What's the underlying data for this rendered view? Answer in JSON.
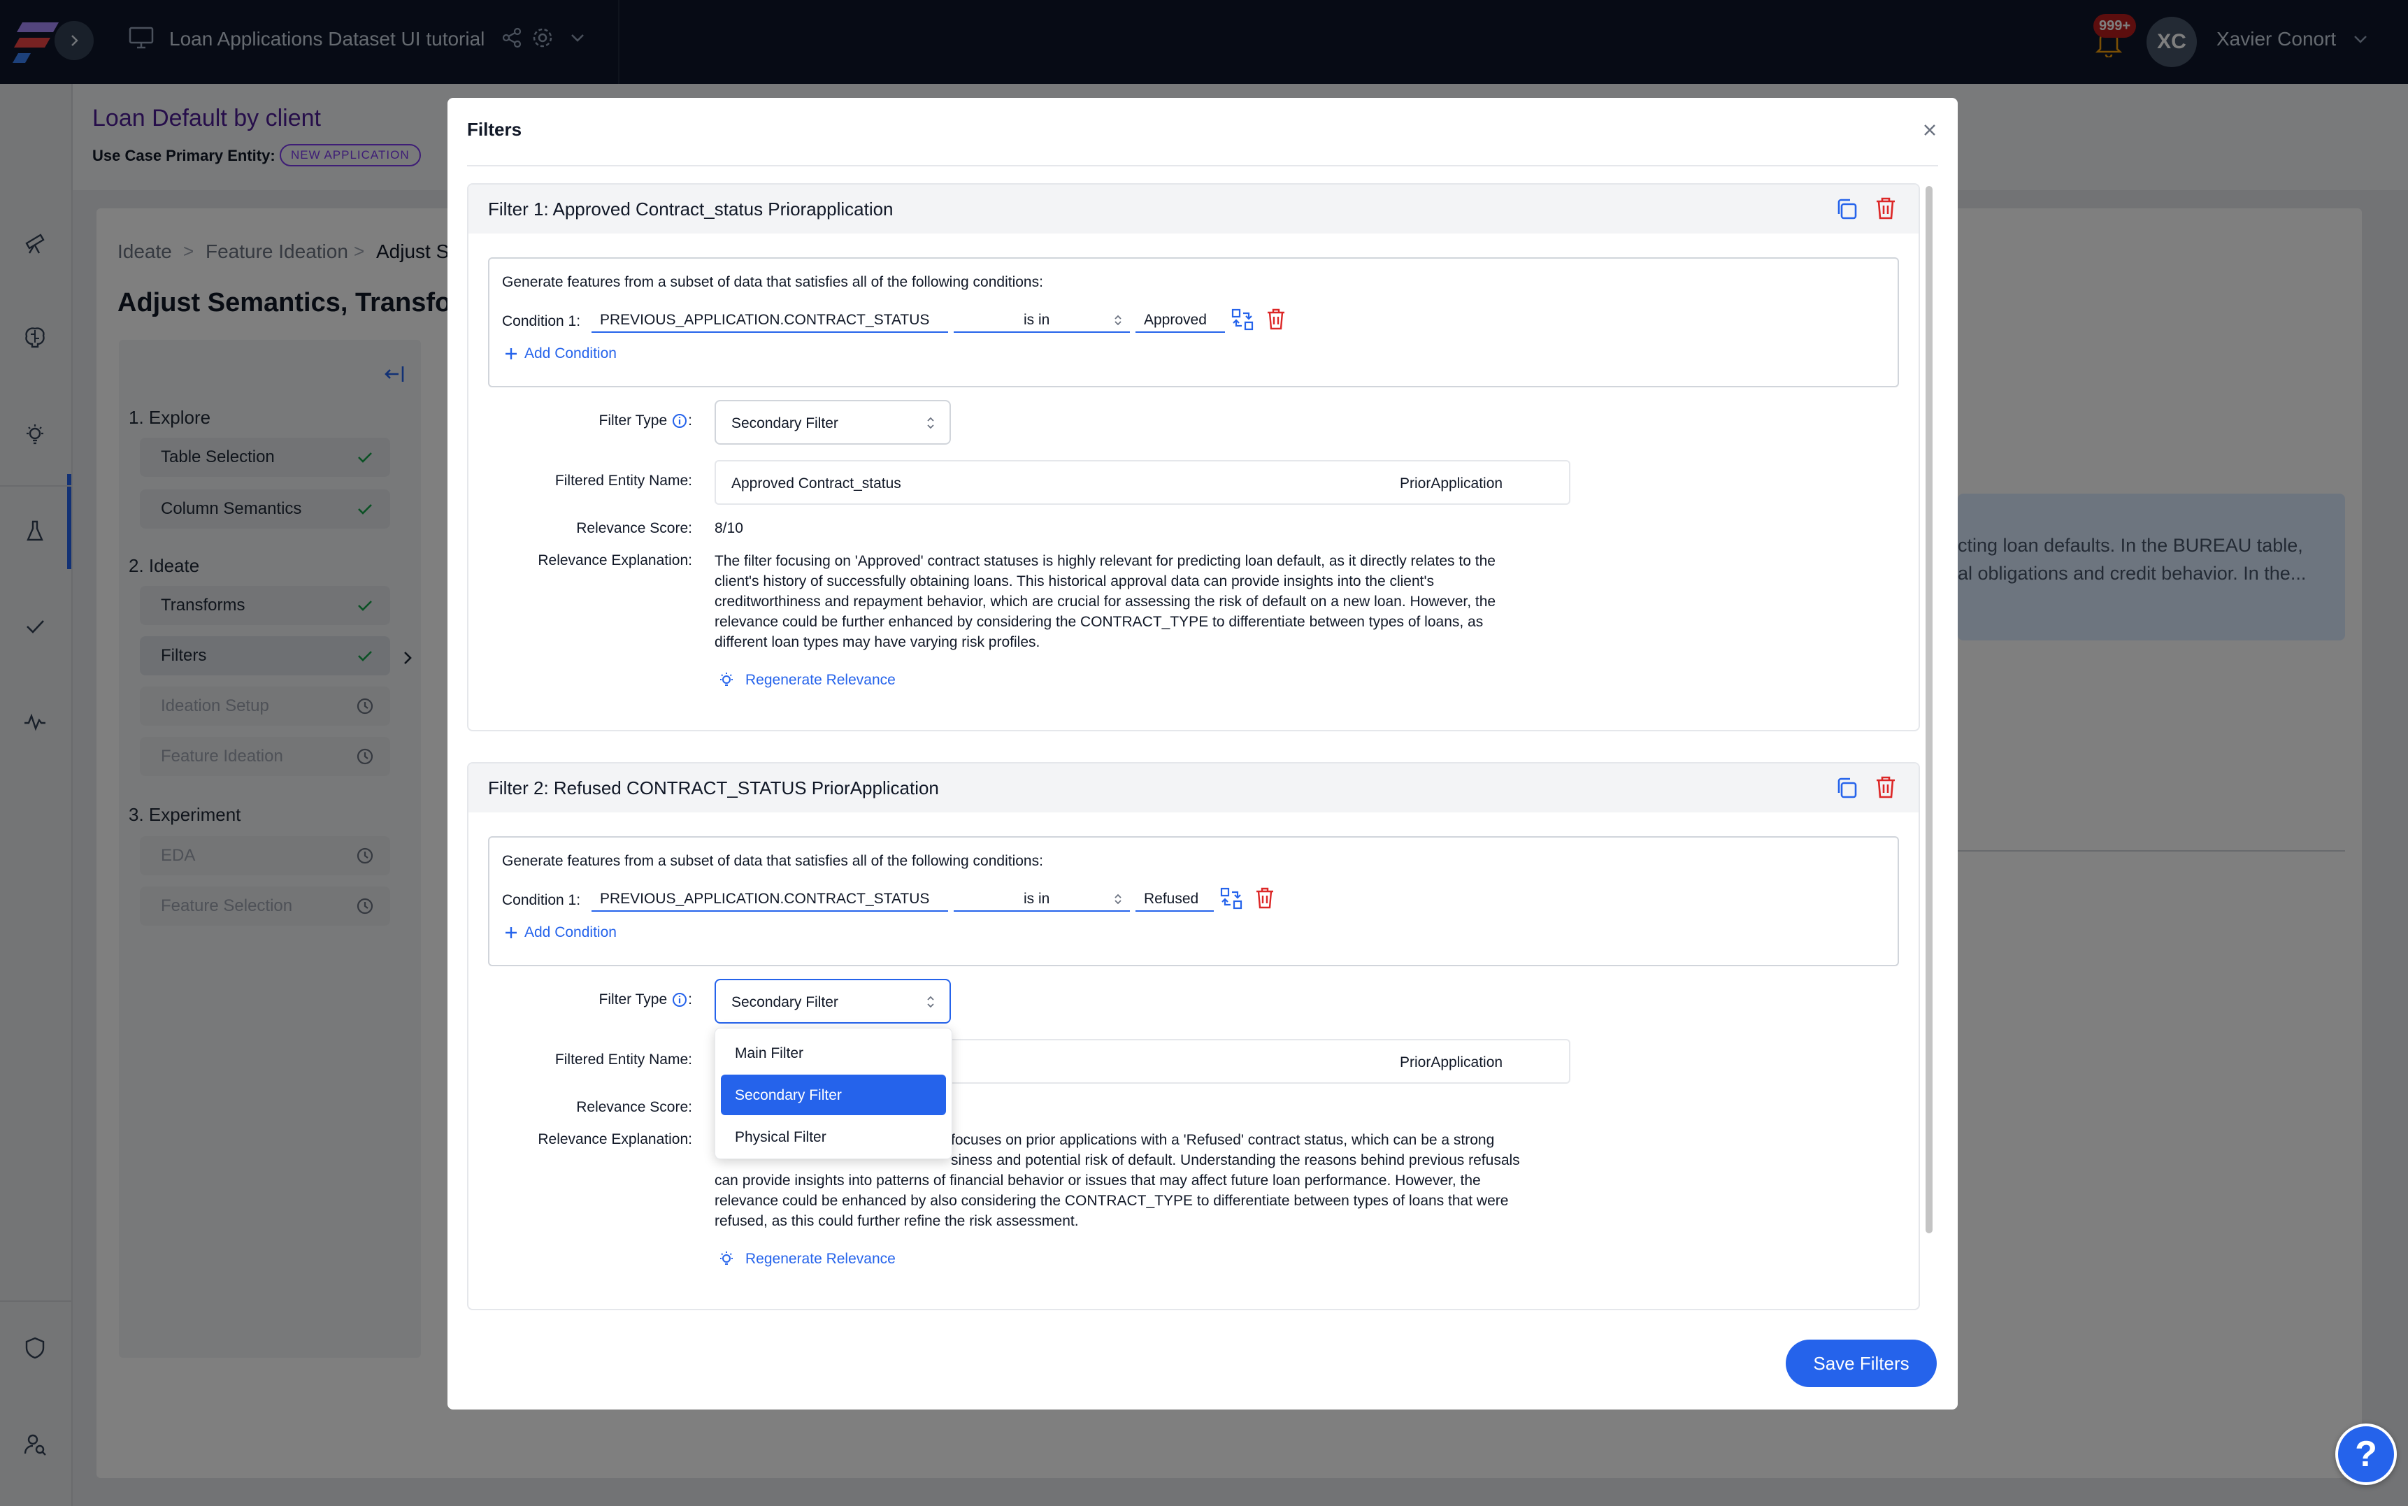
{
  "topbar": {
    "workspace_title": "Loan Applications Dataset UI tutorial",
    "notification_count": "999+",
    "user_initials": "XC",
    "user_name": "Xavier Conort"
  },
  "page": {
    "use_case_title": "Loan Default by client",
    "primary_entity_label": "Use Case Primary Entity:",
    "primary_entity_value": "NEW APPLICATION",
    "breadcrumb": [
      "Ideate",
      "Feature Ideation",
      "Adjust S"
    ],
    "breadcrumb_sep": ">",
    "title": "Adjust Semantics, Transfor",
    "steps": {
      "explore": {
        "label": "1. Explore",
        "items": [
          {
            "label": "Table Selection"
          },
          {
            "label": "Column Semantics"
          }
        ]
      },
      "ideate": {
        "label": "2. Ideate",
        "items": [
          {
            "label": "Transforms"
          },
          {
            "label": "Filters"
          },
          {
            "label": "Ideation Setup"
          },
          {
            "label": "Feature Ideation"
          }
        ]
      },
      "experiment": {
        "label": "3. Experiment",
        "items": [
          {
            "label": "EDA"
          },
          {
            "label": "Feature Selection"
          }
        ]
      }
    },
    "background_text": [
      "cting loan defaults. In the BUREAU table,",
      "al obligations and credit behavior. In the..."
    ]
  },
  "modal": {
    "title": "Filters",
    "filters": [
      {
        "title": "Filter 1: Approved Contract_status Priorapplication",
        "conditions_intro": "Generate features from a subset of data that satisfies all of the following conditions:",
        "condition_label": "Condition 1:",
        "condition_column": "PREVIOUS_APPLICATION.CONTRACT_STATUS",
        "condition_operator": "is in",
        "condition_value": "Approved",
        "add_condition": "Add Condition",
        "filter_type_label": "Filter Type",
        "filter_type_value": "Secondary Filter",
        "entity_name_label": "Filtered Entity Name:",
        "entity_name_value": "Approved Contract_status",
        "entity_name_suffix": "PriorApplication",
        "relevance_score_label": "Relevance Score:",
        "relevance_score_value": "8/10",
        "relevance_explanation_label": "Relevance Explanation:",
        "relevance_explanation_lines": [
          "The filter focusing on 'Approved' contract statuses is highly relevant for predicting loan default, as it directly relates to the",
          "client's history of successfully obtaining loans. This historical approval data can provide insights into the client's",
          "creditworthiness and repayment behavior, which are crucial for assessing the risk of default on a new loan. However, the",
          "relevance could be further enhanced by considering the CONTRACT_TYPE to differentiate between types of loans, as",
          "different loan types may have varying risk profiles."
        ],
        "regenerate_label": "Regenerate Relevance"
      },
      {
        "title": "Filter 2: Refused CONTRACT_STATUS PriorApplication",
        "conditions_intro": "Generate features from a subset of data that satisfies all of the following conditions:",
        "condition_label": "Condition 1:",
        "condition_column": "PREVIOUS_APPLICATION.CONTRACT_STATUS",
        "condition_operator": "is in",
        "condition_value": "Refused",
        "add_condition": "Add Condition",
        "filter_type_label": "Filter Type",
        "filter_type_value": "Secondary Filter",
        "entity_name_label": "Filtered Entity Name:",
        "entity_name_suffix": "PriorApplication",
        "relevance_score_label": "Relevance Score:",
        "relevance_explanation_label": "Relevance Explanation:",
        "relevance_explanation_lines": [
          "focuses on prior applications with a 'Refused' contract status, which can be a strong",
          "siness and potential risk of default. Understanding the reasons behind previous refusals",
          "can provide insights into patterns of financial behavior or issues that may affect future loan performance. However, the",
          "relevance could be enhanced by also considering the CONTRACT_TYPE to differentiate between types of loans that were",
          "refused, as this could further refine the risk assessment."
        ],
        "regenerate_label": "Regenerate Relevance"
      }
    ],
    "dropdown_options": [
      {
        "label": "Main Filter",
        "selected": false
      },
      {
        "label": "Secondary Filter",
        "selected": true
      },
      {
        "label": "Physical Filter",
        "selected": false
      }
    ],
    "save_label": "Save Filters"
  },
  "help_label": "?",
  "colors": {
    "accent": "#2563eb",
    "danger": "#dc2626",
    "brand_purple": "#7c3aed",
    "success": "#16a34a"
  }
}
